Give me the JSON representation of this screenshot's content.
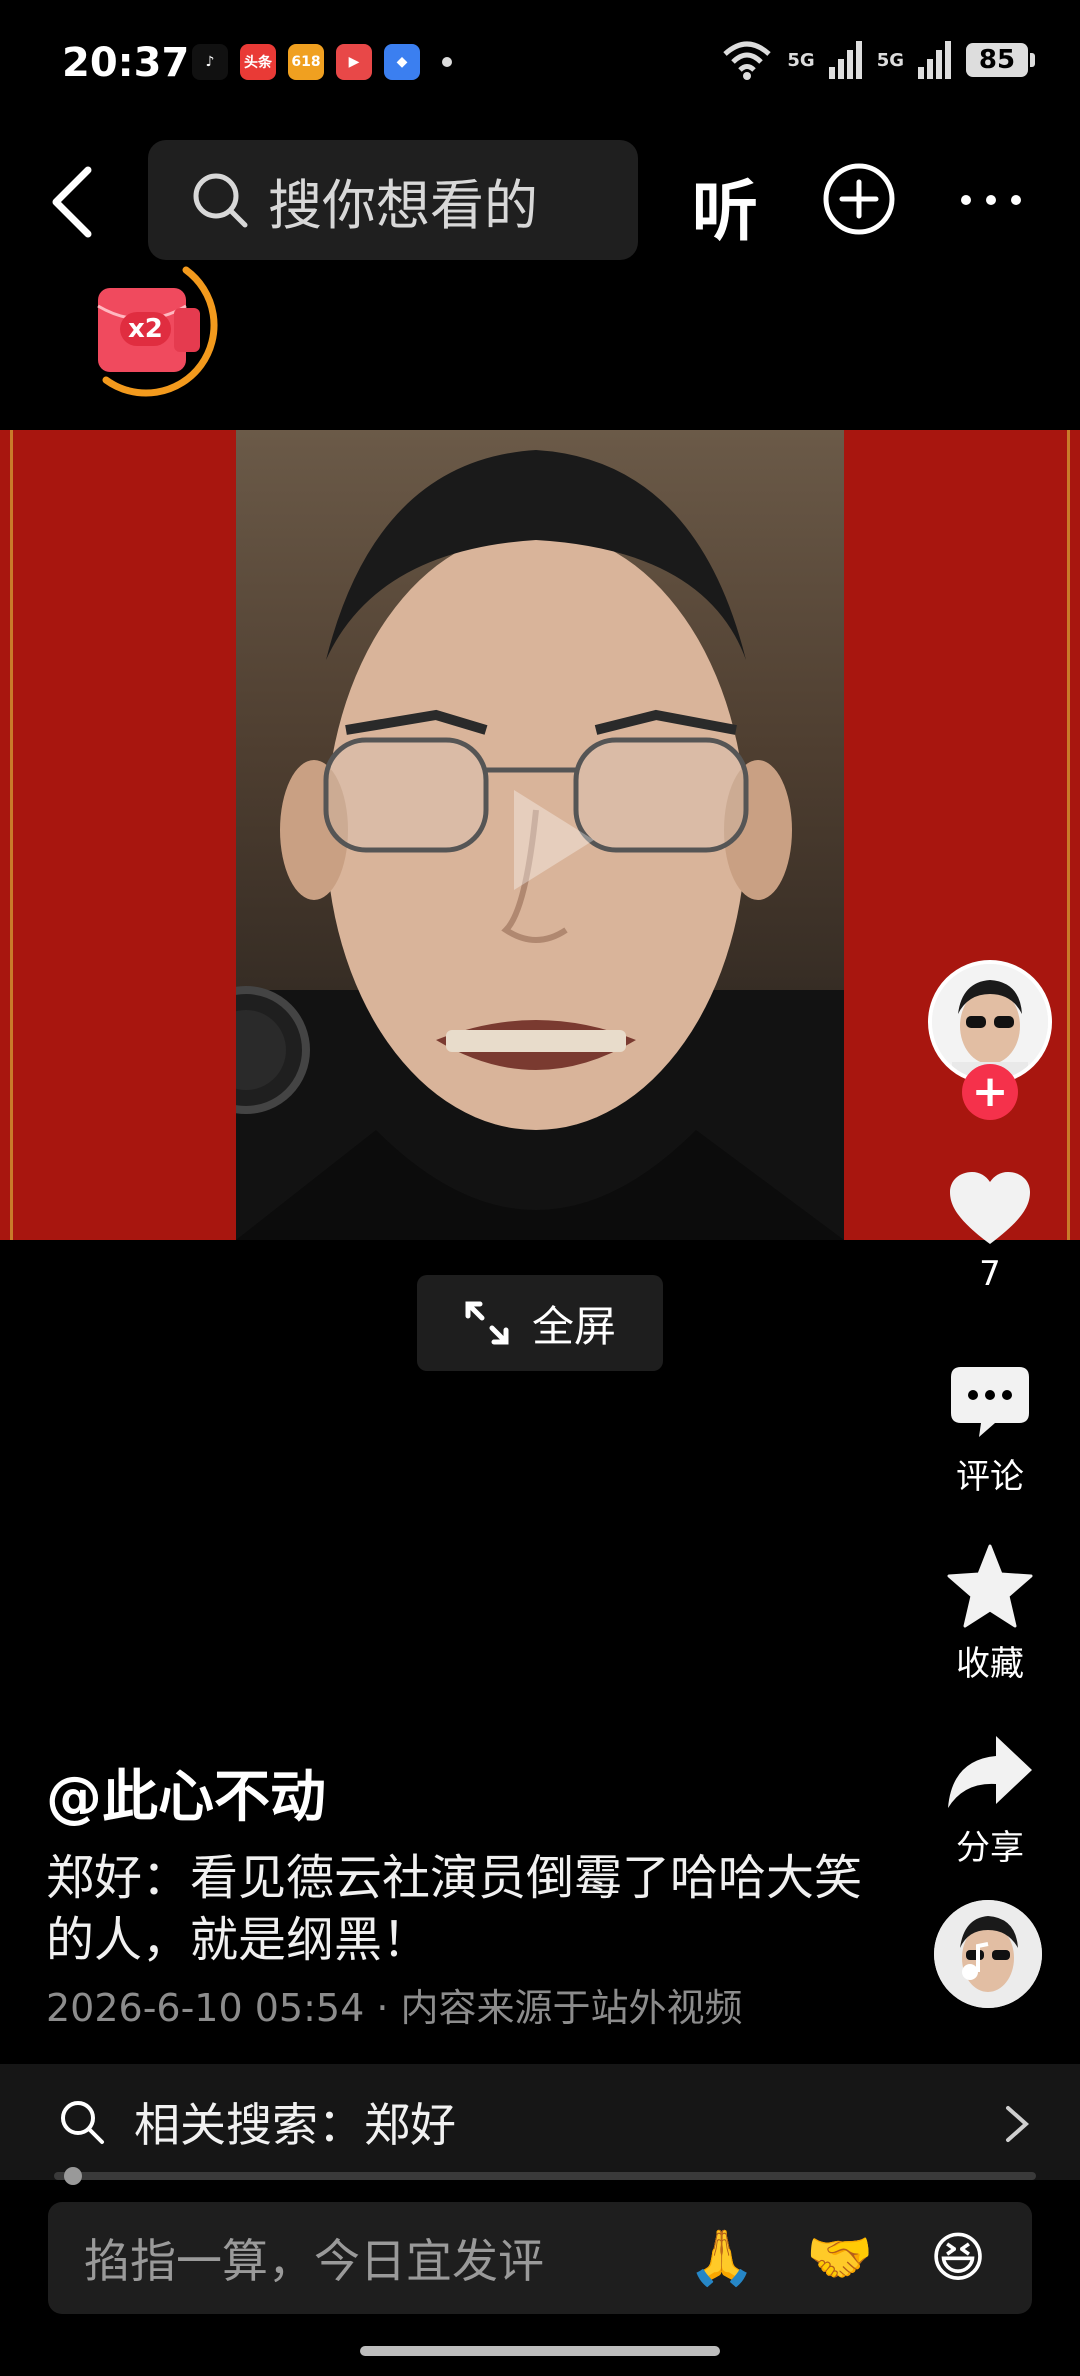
{
  "status": {
    "time": "20:37",
    "notifications": [
      {
        "name": "tiktok-icon",
        "text": "♪",
        "color": "#111111"
      },
      {
        "name": "toutiao-icon",
        "text": "头条",
        "color": "#e93a36"
      },
      {
        "name": "taobao-icon",
        "text": "618",
        "color": "#f0a020"
      },
      {
        "name": "video-app-icon",
        "text": "▶",
        "color": "#e84848"
      },
      {
        "name": "browser-app-icon",
        "text": "◆",
        "color": "#3b7ff0"
      }
    ],
    "signal_1": "5G",
    "signal_2": "5G",
    "battery": "85"
  },
  "topbar": {
    "search_placeholder": "搜你想看的",
    "listen_label": "听"
  },
  "red_packet": {
    "badge": "x2"
  },
  "fullscreen_label": "全屏",
  "actions": {
    "likes": "7",
    "comment_label": "评论",
    "favorite_label": "收藏",
    "share_label": "分享"
  },
  "post": {
    "username": "@此心不动",
    "description": "郑好：看见德云社演员倒霉了哈哈大笑的人，就是纲黑！",
    "meta": "2026-6-10 05:54 · 内容来源于站外视频"
  },
  "related_search": {
    "label": "相关搜索：郑好"
  },
  "comment_bar": {
    "placeholder": "掐指一算，今日宜发评",
    "emojis": [
      "🙏",
      "🤝",
      "😆"
    ]
  },
  "progress": 0.01,
  "colors": {
    "accent_red": "#f5314b",
    "video_bg": "#a8160f",
    "ring_orange": "#f39a1d"
  }
}
